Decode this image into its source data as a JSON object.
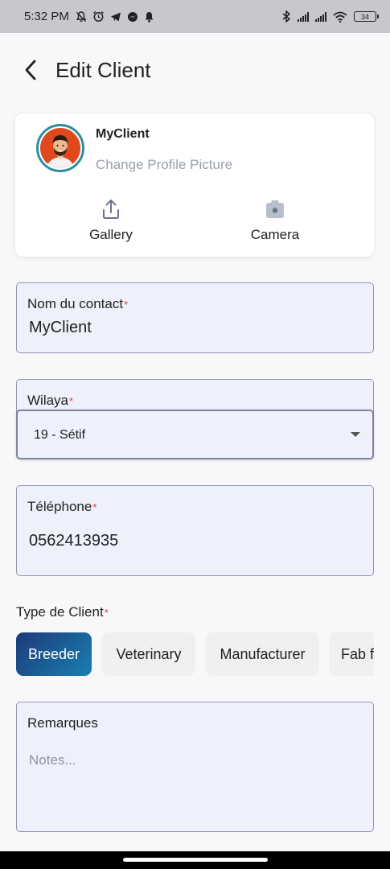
{
  "status_bar": {
    "time": "5:32 PM",
    "battery": "34",
    "left_icons": [
      "mute-icon",
      "alarm-icon",
      "telegram-icon",
      "messenger-icon",
      "notification-icon"
    ],
    "right_icons": [
      "bluetooth-icon",
      "signal-icon",
      "signal-icon",
      "wifi-icon",
      "battery-icon"
    ]
  },
  "header": {
    "title": "Edit Client",
    "back_icon": "arrow-left-icon"
  },
  "profile": {
    "name": "MyClient",
    "change_picture": "Change Profile Picture",
    "gallery_label": "Gallery",
    "camera_label": "Camera"
  },
  "form": {
    "contact": {
      "label": "Nom du contact",
      "required": "*",
      "value": "MyClient"
    },
    "wilaya": {
      "label": "Wilaya",
      "required": "*",
      "selected": "19 - Sétif"
    },
    "phone": {
      "label": "Téléphone",
      "required": "*",
      "value": "0562413935"
    },
    "client_type": {
      "label": "Type de Client",
      "required": "*",
      "options": [
        "Breeder",
        "Veterinary",
        "Manufacturer",
        "Fab f"
      ],
      "selected": "Breeder"
    },
    "remarks": {
      "label": "Remarques",
      "placeholder": "Notes..."
    }
  },
  "colors": {
    "accent_start": "#1d3a7a",
    "accent_end": "#197fb0",
    "required": "#e53935",
    "field_bg": "#eef0fb",
    "avatar_ring": "#2f8ea3"
  }
}
